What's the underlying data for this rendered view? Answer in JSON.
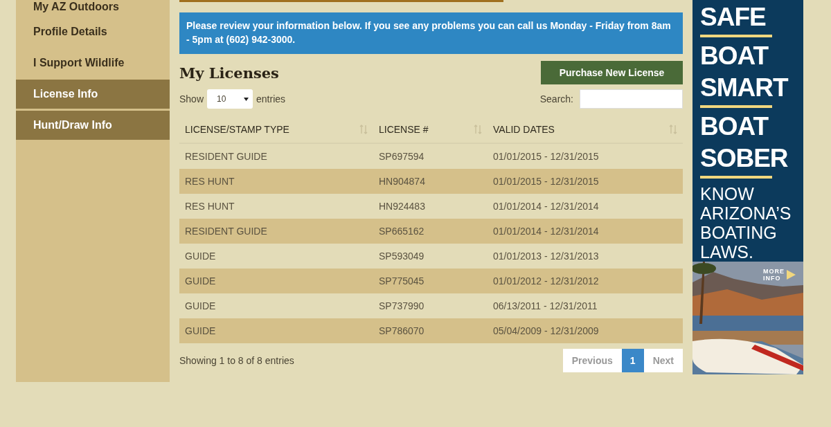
{
  "sidebar": {
    "items": [
      {
        "label": "My AZ Outdoors",
        "highlighted": false
      },
      {
        "label": "Profile Details",
        "highlighted": false
      },
      {
        "label": "I Support Wildlife",
        "highlighted": false
      },
      {
        "label": "License Info",
        "highlighted": true
      },
      {
        "label": "Hunt/Draw Info",
        "highlighted": true
      }
    ]
  },
  "notice": "Please review your information below. If you see any problems you can call us Monday - Friday from 8am - 5pm at (602) 942-3000.",
  "heading": "My Licenses",
  "purchase_button": "Purchase New License",
  "length_control": {
    "prefix": "Show",
    "value": "10",
    "suffix": "entries"
  },
  "search": {
    "label": "Search:"
  },
  "table": {
    "columns": [
      "LICENSE/STAMP TYPE",
      "LICENSE #",
      "VALID DATES"
    ],
    "rows": [
      [
        "RESIDENT GUIDE",
        "SP697594",
        "01/01/2015 - 12/31/2015"
      ],
      [
        "RES HUNT",
        "HN904874",
        "01/01/2015 - 12/31/2015"
      ],
      [
        "RES HUNT",
        "HN924483",
        "01/01/2014 - 12/31/2014"
      ],
      [
        "RESIDENT GUIDE",
        "SP665162",
        "01/01/2014 - 12/31/2014"
      ],
      [
        "GUIDE",
        "SP593049",
        "01/01/2013 - 12/31/2013"
      ],
      [
        "GUIDE",
        "SP775045",
        "01/01/2012 - 12/31/2012"
      ],
      [
        "GUIDE",
        "SP737990",
        "06/13/2011 - 12/31/2011"
      ],
      [
        "GUIDE",
        "SP786070",
        "05/04/2009 - 12/31/2009"
      ]
    ]
  },
  "info": "Showing 1 to 8 of 8 entries",
  "pagination": [
    {
      "label": "Previous",
      "selected": false
    },
    {
      "label": "1",
      "selected": true
    },
    {
      "label": "Next",
      "selected": false
    }
  ],
  "ad": {
    "headlines": [
      "SAFE",
      "BOAT SMART",
      "BOAT SOBER"
    ],
    "tagline": "KNOW ARIZONA’S BOATING LAWS.",
    "more": "MORE INFO"
  }
}
